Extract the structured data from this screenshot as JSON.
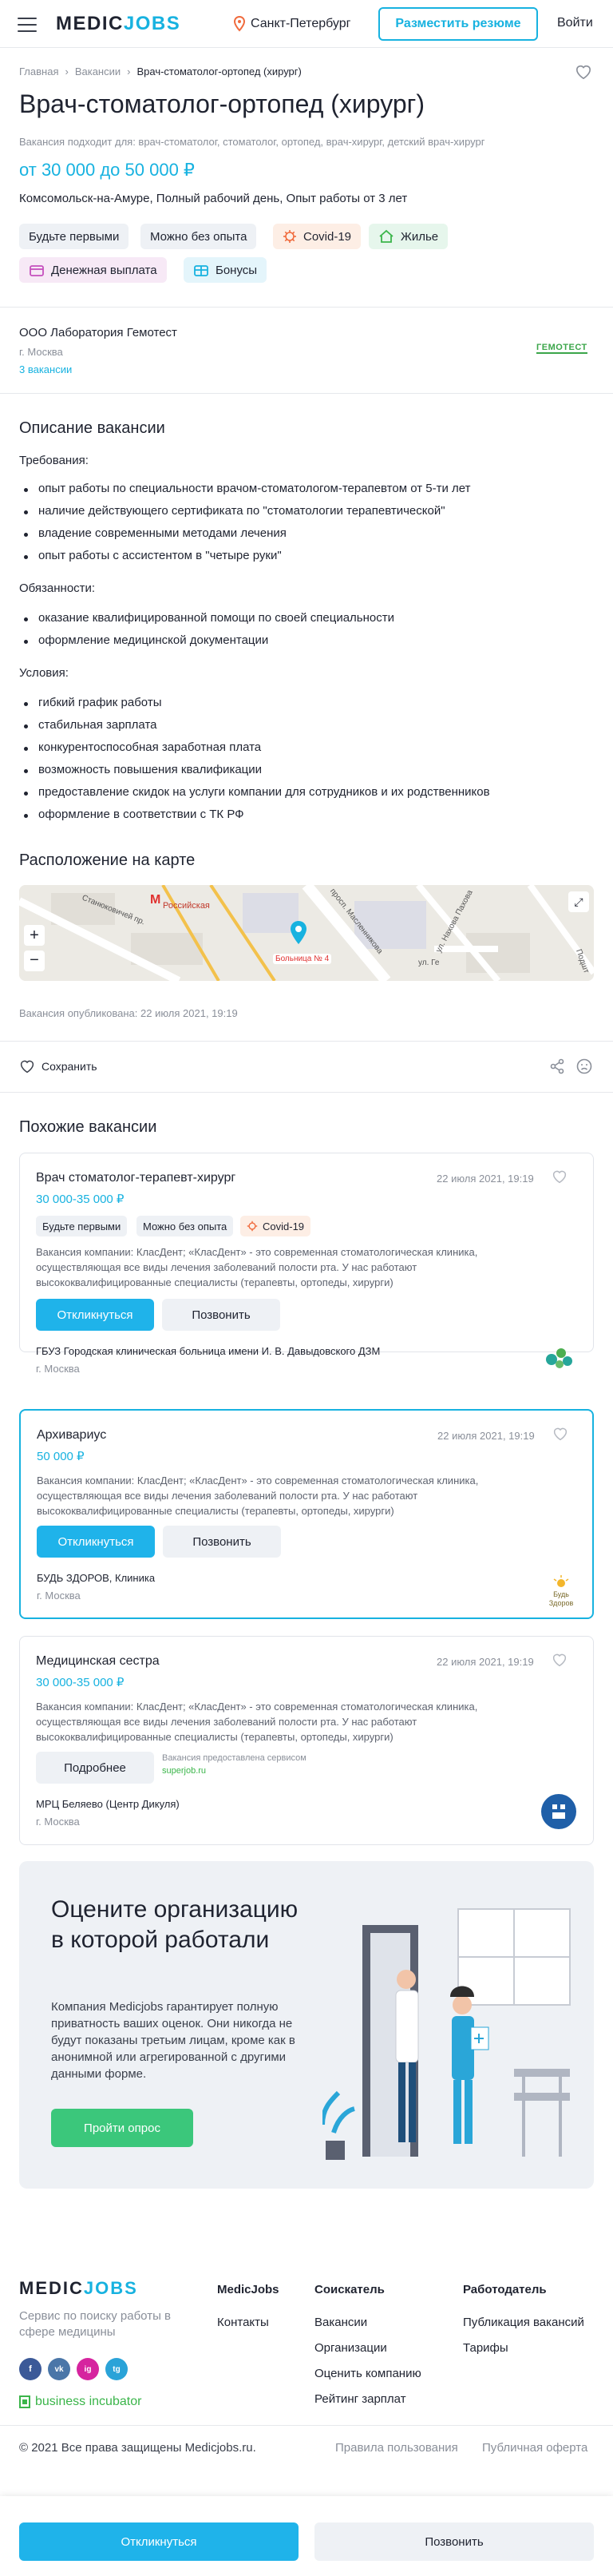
{
  "header": {
    "logo_part1": "MEDIC",
    "logo_part2": "JOBS",
    "city": "Санкт-Петербург",
    "post_resume": "Разместить резюме",
    "login": "Войти"
  },
  "breadcrumbs": [
    "Главная",
    "Вакансии",
    "Врач-стоматолог-ортопед (хирург)"
  ],
  "vacancy": {
    "title": "Врач-стоматолог-ортопед (хирург)",
    "suits": "Вакансия подходит для: врач-стоматолог, стоматолог, ортопед, врач-хирург, детский врач-хирург",
    "salary": "от 30 000 до 50 000 ₽",
    "conditions": "Комсомольск-на-Амуре, Полный рабочий день, Опыт работы от 3 лет",
    "tags": [
      "Будьте первыми",
      "Можно без опыта",
      "Covid-19",
      "Жилье",
      "Денежная выплата",
      "Бонусы"
    ]
  },
  "company": {
    "name": "ООО Лаборатория Гемотест",
    "city": "г. Москва",
    "vacancies": "3 вакансии",
    "logo_text": "ГЕМОТЕСТ"
  },
  "description": {
    "title": "Описание вакансии",
    "req_title": "Требования:",
    "requirements": [
      "опыт работы по специальности врачом-стоматологом-терапевтом от 5-ти лет",
      "наличие действующего сертификата по \"стоматологии терапевтической\"",
      "владение современными методами лечения",
      "опыт работы с ассистентом в \"четыре руки\""
    ],
    "duties_title": "Обязанности:",
    "duties": [
      "оказание квалифицированной помощи по своей специальности",
      "оформление медицинской документации"
    ],
    "cond_title": "Условия:",
    "conditions": [
      "гибкий график работы",
      "стабильная зарплата",
      "конкурентоспособная заработная плата",
      "возможность повышения квалификации",
      "предоставление скидок на услуги компании для сотрудников и их родственников",
      "оформление в соответствии с ТК РФ"
    ]
  },
  "map": {
    "title": "Расположение на карте",
    "metro": "Российская",
    "marker": "Больница № 4",
    "street1": "Станюковичей пр.",
    "street2": "просп. Масленникова",
    "street3": "ул. Нахова Пахова",
    "street4": "ул. Ге",
    "street5": "Подшт"
  },
  "published": "Вакансия опубликована: 22 июля 2021, 19:19",
  "actions": {
    "save": "Сохранить"
  },
  "similar": {
    "title": "Похожие вакансии",
    "cards": [
      {
        "title": "Врач стоматолог-терапевт-хирург",
        "date": "22 июля 2021, 19:19",
        "salary": "30 000-35 000 ₽",
        "tags": [
          "Будьте первыми",
          "Можно без опыта",
          "Covid-19"
        ],
        "desc": "Вакансия компании: КласДент; «КласДент» - это современная стоматологическая клиника, осуществляющая все виды лечения заболеваний полости рта. У нас работают высококвалифицированные специалисты (терапевты, ортопеды, хирурги)",
        "apply": "Откликнуться",
        "call": "Позвонить",
        "org": "ГБУЗ Городская клиническая больница имени И. В. Давыдовского ДЗМ",
        "city": "г. Москва"
      },
      {
        "title": "Архивариус",
        "date": "22 июля 2021, 19:19",
        "salary": "50 000 ₽",
        "desc": "Вакансия компании: КласДент; «КласДент» - это современная стоматологическая клиника, осуществляющая все виды лечения заболеваний полости рта. У нас работают высококвалифицированные специалисты (терапевты, ортопеды, хирурги)",
        "apply": "Откликнуться",
        "call": "Позвонить",
        "org": "БУДЬ ЗДОРОВ, Клиника",
        "city": "г. Москва",
        "logo_text": "Будь Здоров"
      },
      {
        "title": "Медицинская сестра",
        "date": "22 июля 2021, 19:19",
        "salary": "30 000-35 000 ₽",
        "desc": "Вакансия компании: КласДент; «КласДент» - это современная стоматологическая клиника, осуществляющая все виды лечения заболеваний полости рта. У нас работают высококвалифицированные специалисты (терапевты, ортопеды, хирурги)",
        "more": "Подробнее",
        "provided": "Вакансия предоставлена сервисом",
        "provider": "superjob.ru",
        "org": "МРЦ Беляево (Центр Дикуля)",
        "city": "г. Москва"
      }
    ]
  },
  "promo": {
    "title": "Оцените организацию в которой работали",
    "text": "Компания Medicjobs гарантирует полную приватность ваших оценок. Они никогда не будут показаны третьим лицам, кроме как в анонимной или агрегированной с другими данными форме.",
    "button": "Пройти опрос"
  },
  "footer": {
    "logo_part1": "MEDIC",
    "logo_part2": "JOBS",
    "tagline": "Сервис по поиску работы в сфере медицины",
    "incubator": "business incubator",
    "social": [
      "f",
      "vk",
      "ig",
      "tg"
    ],
    "col1": {
      "title": "MedicJobs",
      "items": [
        "Контакты"
      ]
    },
    "col2": {
      "title": "Соискатель",
      "items": [
        "Вакансии",
        "Организации",
        "Оценить компанию",
        "Рейтинг зарплат"
      ]
    },
    "col3": {
      "title": "Работодатель",
      "items": [
        "Публикация вакансий",
        "Тарифы"
      ]
    },
    "copyright": "© 2021 Все права защищены Medicjobs.ru.",
    "terms": "Правила пользования",
    "offer": "Публичная оферта"
  },
  "bottom": {
    "apply": "Откликнуться",
    "call": "Позвонить"
  },
  "colors": {
    "accent": "#17b2e0",
    "green": "#3bc77b"
  }
}
